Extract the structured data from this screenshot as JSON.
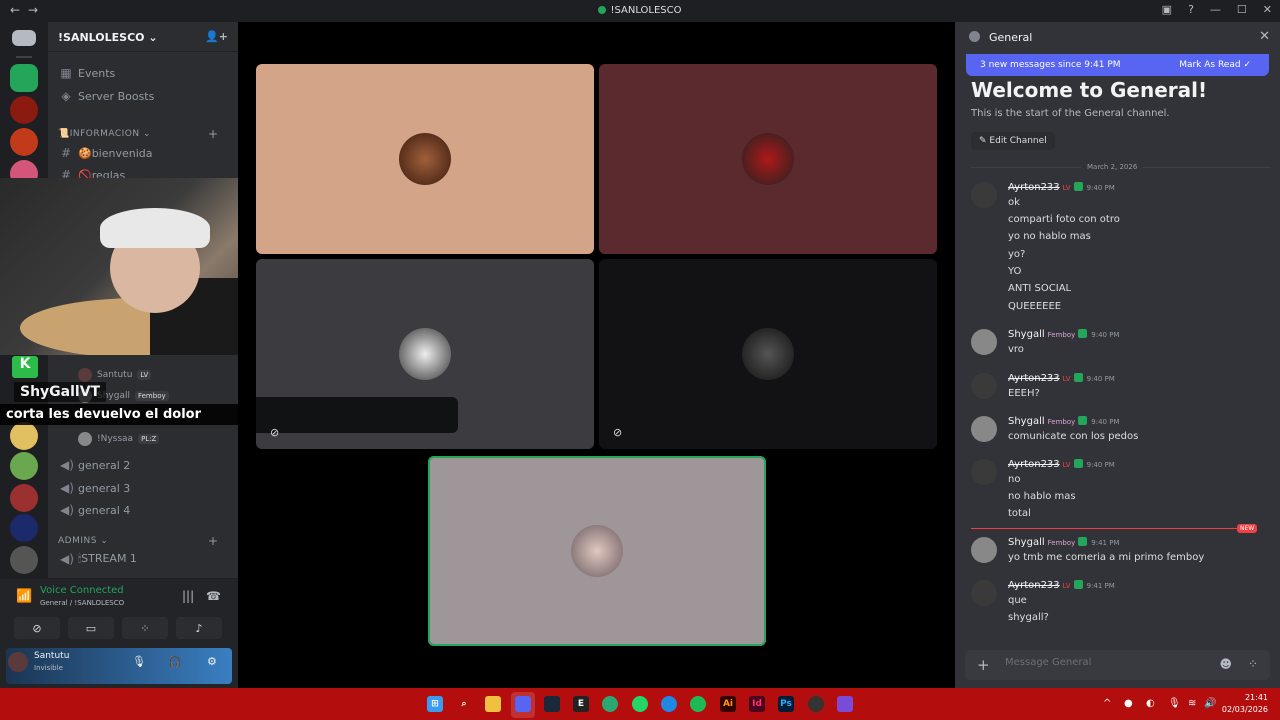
{
  "window": {
    "title": "!SANLOLESCO"
  },
  "server": {
    "name": "!SANLOLESCO"
  },
  "channels": {
    "top": [
      {
        "label": "Events"
      },
      {
        "label": "Server Boosts"
      }
    ],
    "category_info": "📜INFORMACION",
    "info_channels": [
      {
        "label": "🍪bienvenida"
      },
      {
        "label": "🚫reglas"
      }
    ],
    "voice_users": [
      {
        "name": "Santutu",
        "badge": "LV"
      },
      {
        "name": "Shygall",
        "badge": "Femboy"
      },
      {
        "name": "!Nyssaa",
        "badge": "PL:Z"
      }
    ],
    "voice_channels": [
      {
        "label": "general 2"
      },
      {
        "label": "general 3"
      },
      {
        "label": "general 4"
      }
    ],
    "category_admins": "ADMINS",
    "admin_channels": [
      {
        "label": "🕯STREAM 1"
      }
    ]
  },
  "voice": {
    "status": "Voice Connected",
    "location": "General / !SANLOLESCO"
  },
  "user": {
    "name": "Santutu",
    "status": "Invisible"
  },
  "overlay": {
    "streamer": "ShyGallVT",
    "caption": "corta les devuelvo el dolor"
  },
  "chat": {
    "channel": "General",
    "new_messages": "3 new messages since 9:41 PM",
    "mark_read": "Mark As Read",
    "welcome_title": "Welcome to General!",
    "welcome_sub": "This is the start of the General channel.",
    "edit_channel": "Edit Channel",
    "date": "March 2, 2026",
    "new_label": "NEW",
    "messages": [
      {
        "author": "Ayrton233",
        "tag": "LV",
        "time": "9:40 PM",
        "lines": [
          "ok",
          "comparti foto con otro",
          "yo no hablo mas",
          "yo?",
          "YO",
          "ANTI SOCIAL",
          "QUEEEEEE"
        ]
      },
      {
        "author": "Shygall",
        "tag": "Femboy",
        "time": "9:40 PM",
        "lines": [
          "vro"
        ]
      },
      {
        "author": "Ayrton233",
        "tag": "LV",
        "time": "9:40 PM",
        "lines": [
          "EEEH?"
        ]
      },
      {
        "author": "Shygall",
        "tag": "Femboy",
        "time": "9:40 PM",
        "lines": [
          "comunicate con los pedos"
        ]
      },
      {
        "author": "Ayrton233",
        "tag": "LV",
        "time": "9:40 PM",
        "lines": [
          "no",
          "no hablo mas",
          "total"
        ]
      },
      {
        "author": "Shygall",
        "tag": "Femboy",
        "time": "9:41 PM",
        "lines": [
          "yo tmb me comeria a mi primo femboy"
        ]
      },
      {
        "author": "Ayrton233",
        "tag": "LV",
        "time": "9:41 PM",
        "lines": [
          "que",
          "shygall?"
        ]
      }
    ],
    "input_placeholder": "Message General"
  },
  "taskbar": {
    "time": "21:41",
    "date": "02/03/2026"
  },
  "colors": {
    "accent": "#5865f2",
    "voice_green": "#23a55a",
    "taskbar": "#b40d0d"
  }
}
